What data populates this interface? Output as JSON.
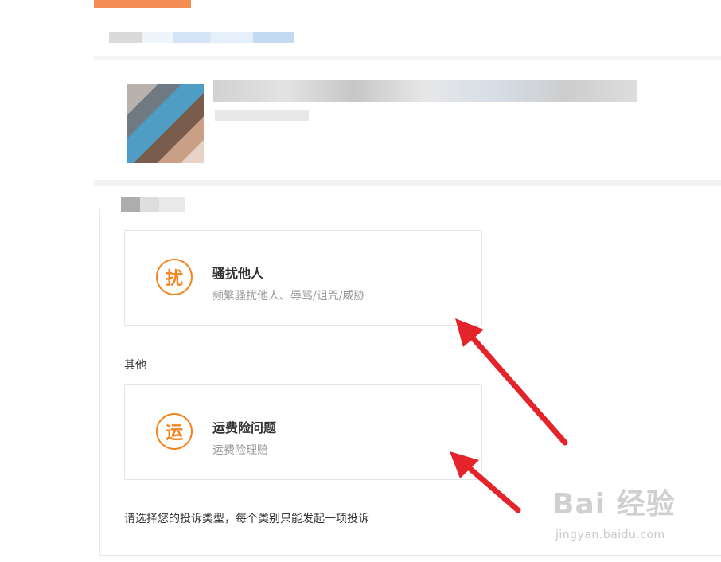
{
  "sections": {
    "other_label": "其他"
  },
  "cards": [
    {
      "badge": "扰",
      "title": "骚扰他人",
      "desc": "频繁骚扰他人、辱骂/诅咒/威胁"
    },
    {
      "badge": "运",
      "title": "运费险问题",
      "desc": "运费险理赔"
    }
  ],
  "footer": {
    "tip": "请选择您的投诉类型，每个类别只能发起一项投诉"
  },
  "watermark": {
    "logo": "Bai 经验",
    "url": "jingyan.baidu.com"
  },
  "colors": {
    "accent": "#f5841f",
    "arrow": "#e5232a"
  }
}
